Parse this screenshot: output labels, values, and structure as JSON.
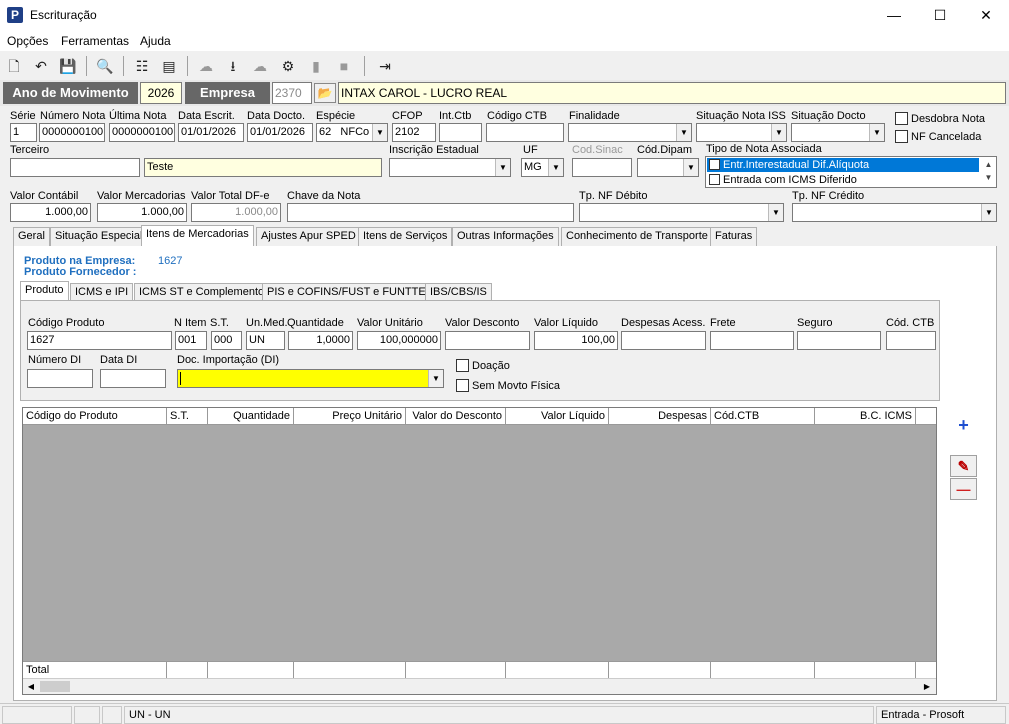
{
  "window": {
    "title": "Escrituração",
    "minimize": "—",
    "maximize": "☐",
    "close": "✕"
  },
  "menu": [
    "Opções",
    "Ferramentas",
    "Ajuda"
  ],
  "header": {
    "ano_label": "Ano de Movimento",
    "ano_value": "2026",
    "empresa_label": "Empresa",
    "empresa_code": "2370",
    "empresa_name": "INTAX CAROL - LUCRO REAL"
  },
  "fields": {
    "serie": {
      "label": "Série",
      "value": "1"
    },
    "numero_nota": {
      "label": "Número Nota",
      "value": "0000000100"
    },
    "ultima_nota": {
      "label": "Última Nota",
      "value": "0000000100"
    },
    "data_escrit": {
      "label": "Data Escrit.",
      "value": "01/01/2026"
    },
    "data_docto": {
      "label": "Data Docto.",
      "value": "01/01/2026"
    },
    "especie": {
      "label": "Espécie",
      "value": "62",
      "value2": "NFCo"
    },
    "cfop": {
      "label": "CFOP",
      "value": "2102"
    },
    "int_ctb": {
      "label": "Int.Ctb",
      "value": ""
    },
    "codigo_ctb": {
      "label": "Código CTB",
      "value": ""
    },
    "finalidade": {
      "label": "Finalidade",
      "value": ""
    },
    "situacao_iss": {
      "label": "Situação Nota ISS",
      "value": ""
    },
    "situacao_docto": {
      "label": "Situação Docto",
      "value": ""
    },
    "desdobra": {
      "label": "Desdobra Nota"
    },
    "nf_cancelada": {
      "label": "NF Cancelada"
    },
    "terceiro": {
      "label": "Terceiro",
      "code": "",
      "name": "Teste"
    },
    "inscricao": {
      "label": "Inscrição Estadual",
      "value": ""
    },
    "uf": {
      "label": "UF",
      "value": "MG"
    },
    "cod_sinac": {
      "label": "Cod.Sinac",
      "value": ""
    },
    "cod_dipam": {
      "label": "Cód.Dipam",
      "value": ""
    },
    "tipo_nota": {
      "label": "Tipo de Nota Associada",
      "options": [
        "Entr.Interestadual Dif.Alíquota",
        "Entrada com ICMS Diferido"
      ]
    },
    "valor_contabil": {
      "label": "Valor Contábil",
      "value": "1.000,00"
    },
    "valor_mercadorias": {
      "label": "Valor Mercadorias",
      "value": "1.000,00"
    },
    "valor_total_dfe": {
      "label": "Valor Total DF-e",
      "value": "1.000,00"
    },
    "chave_nota": {
      "label": "Chave da Nota",
      "value": ""
    },
    "tp_nf_debito": {
      "label": "Tp. NF Débito",
      "value": ""
    },
    "tp_nf_credito": {
      "label": "Tp. NF Crédito",
      "value": ""
    }
  },
  "tabs": [
    "Geral",
    "Situação Especial",
    "Itens de Mercadorias",
    "Ajustes Apur SPED",
    "Itens de Serviços",
    "Outras Informações",
    "Conhecimento de Transporte",
    "Faturas"
  ],
  "produto_empresa": {
    "label": "Produto na Empresa:",
    "value": "1627"
  },
  "produto_fornecedor": {
    "label": "Produto Fornecedor :",
    "value": ""
  },
  "subtabs": [
    "Produto",
    "ICMS e IPI",
    "ICMS ST e Complemento",
    "PIS e COFINS/FUST e FUNTTEL",
    "IBS/CBS/IS"
  ],
  "item": {
    "codigo_produto": {
      "label": "Código Produto",
      "value": "1627"
    },
    "n_item": {
      "label": "N Item",
      "value": "001"
    },
    "st": {
      "label": "S.T.",
      "value": "000"
    },
    "un_med": {
      "label": "Un.Med.",
      "value": "UN"
    },
    "quantidade": {
      "label": "Quantidade",
      "value": "1,0000"
    },
    "valor_unitario": {
      "label": "Valor Unitário",
      "value": "100,000000"
    },
    "valor_desconto": {
      "label": "Valor Desconto",
      "value": ""
    },
    "valor_liquido": {
      "label": "Valor Líquido",
      "value": "100,00"
    },
    "despesas": {
      "label": "Despesas Acess.",
      "value": ""
    },
    "frete": {
      "label": "Frete",
      "value": ""
    },
    "seguro": {
      "label": "Seguro",
      "value": ""
    },
    "cod_ctb": {
      "label": "Cód. CTB",
      "value": ""
    },
    "numero_di": {
      "label": "Número DI",
      "value": ""
    },
    "data_di": {
      "label": "Data DI",
      "value": ""
    },
    "doc_importacao": {
      "label": "Doc. Importação (DI)",
      "value": ""
    },
    "doacao": {
      "label": "Doação"
    },
    "sem_movto": {
      "label": "Sem Movto Física"
    }
  },
  "grid": {
    "columns": [
      "Código do Produto",
      "S.T.",
      "Quantidade",
      "Preço Unitário",
      "Valor do Desconto",
      "Valor Líquido",
      "Despesas",
      "Cód.CTB",
      "B.C. ICMS"
    ],
    "total_label": "Total"
  },
  "side_buttons": {
    "add": "+",
    "edit": "✎",
    "remove": "—"
  },
  "status": {
    "s1": "",
    "s2": "",
    "s3": "UN - UN",
    "s4": "",
    "s5": "Entrada - Prosoft"
  },
  "colors": {
    "add": "#1f4fd0",
    "remove": "#d02020",
    "header_dark": "#676767",
    "selected": "#0078d7"
  }
}
